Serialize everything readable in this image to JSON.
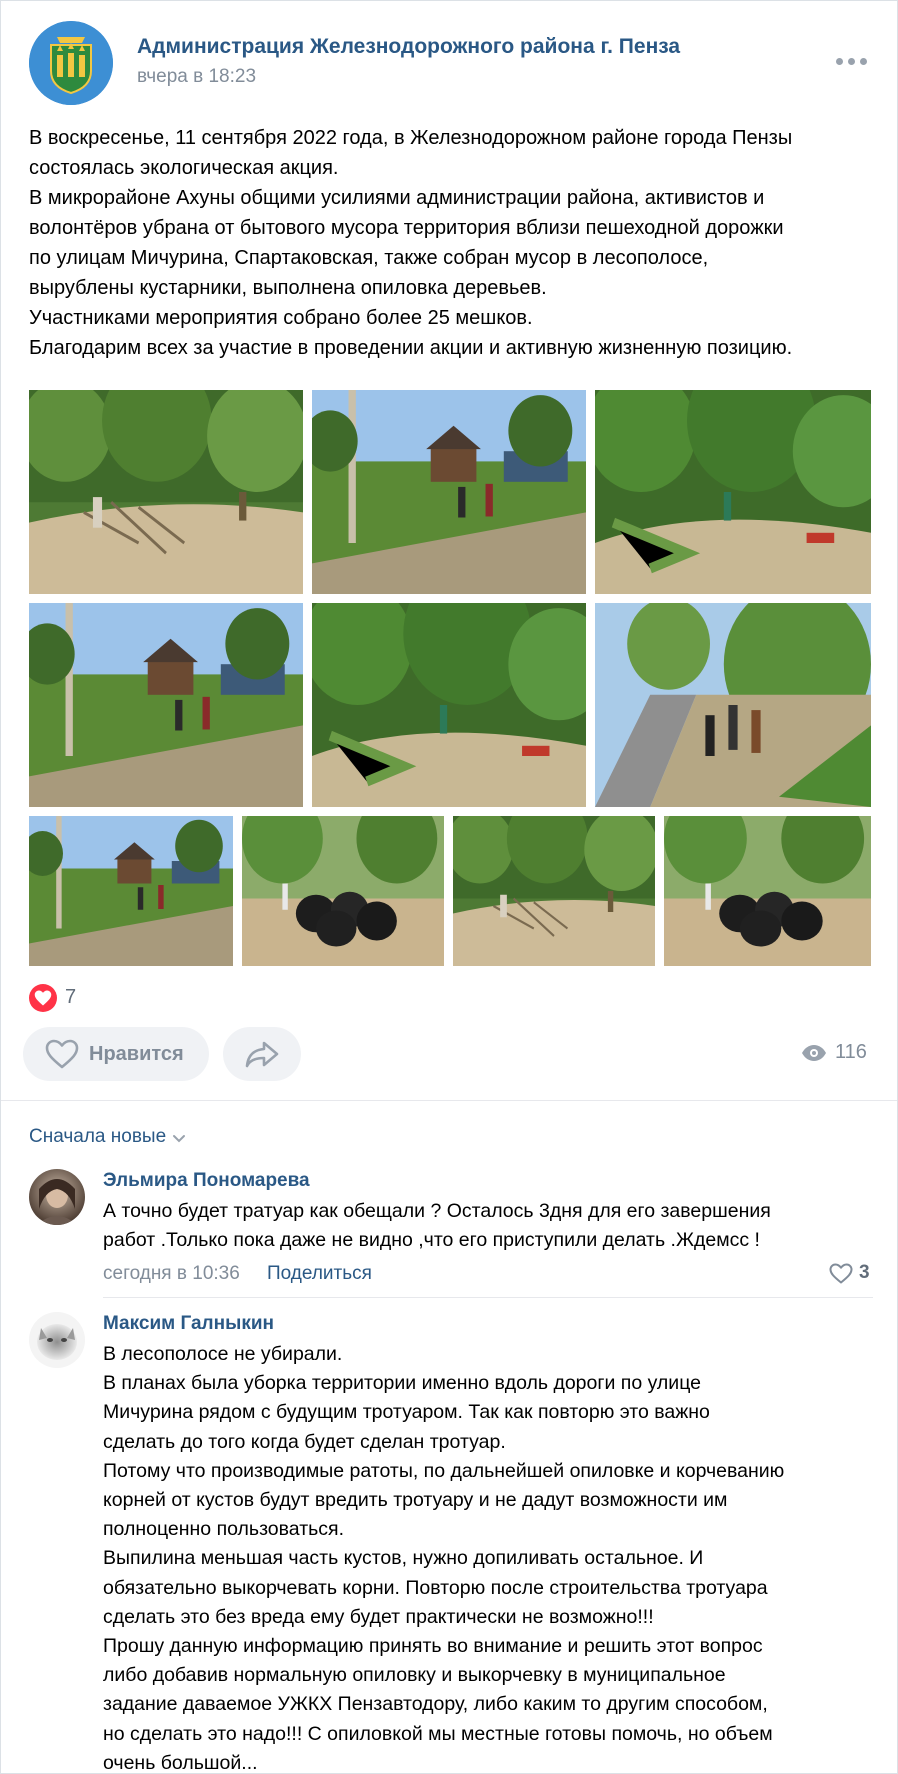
{
  "post": {
    "group_name": "Администрация Железнодорожного района г. Пенза",
    "time": "вчера в 18:23",
    "text_lines": [
      "В воскресенье, 11 сентября 2022 года, в Железнодорожном районе города Пензы",
      "состоялась экологическая акция.",
      "В микрорайоне Ахуны общими усилиями администрации района, активистов и",
      "волонтёров убрана от бытового мусора территория вблизи пешеходной дорожки",
      "по улицам Мичурина, Спартаковская, также собран мусор в лесополосе,",
      "вырублены кустарники, выполнена опиловка деревьев.",
      "Участниками мероприятия собрано более 25 мешков.",
      "Благодарим всех за участие в проведении акции и активную жизненную позицию."
    ],
    "photos": [
      {
        "scene": "trees-sand"
      },
      {
        "scene": "village-road"
      },
      {
        "scene": "forest-edge"
      },
      {
        "scene": "village-road"
      },
      {
        "scene": "forest-edge"
      },
      {
        "scene": "road-people"
      },
      {
        "scene": "village-road"
      },
      {
        "scene": "bags"
      },
      {
        "scene": "trees-sand"
      },
      {
        "scene": "bags"
      }
    ]
  },
  "reactions": {
    "like_count": "7",
    "like_label": "Нравится",
    "views": "116",
    "like_color": "#ff3347"
  },
  "comments_sort": "Сначала новые",
  "comments": [
    {
      "author": "Эльмира Пономарева",
      "lines": [
        "А точно будет тратуар как обещали ? Осталось 3дня для его завершения",
        "работ .Только пока даже не видно ,что его приступили делать .Ждемсс !"
      ],
      "time": "сегодня в 10:36",
      "share_label": "Поделиться",
      "likes": "3"
    },
    {
      "author": "Максим Галныкин",
      "lines": [
        "В лесополосе не убирали.",
        "В планах была уборка территории именно вдоль дороги по улице",
        "Мичурина рядом с будущим тротуаром. Так как повторю это важно",
        "сделать до того когда будет сделан тротуар.",
        "Потому что производимые ратоты, по дальнейшей опиловке и корчеванию",
        "корней от кустов будут вредить тротуару и не дадут возможности им",
        "полноценно пользоваться.",
        "Выпилина меньшая часть кустов, нужно допиливать остальное. И",
        "обязательно выкорчевать корни. Повторю после строительства тротуара",
        "сделать это без вреда ему будет практически не возможно!!!",
        "Прошу данную информацию принять во внимание и решить этот вопрос",
        "либо добавив нормальную опиловку и выкорчевку в муниципальное",
        "задание даваемое УЖКХ Пензавтодору, либо каким то другим способом,",
        "но сделать это надо!!! С опиловкой мы местные готовы помочь, но объем",
        "очень большой..."
      ]
    }
  ],
  "colors": {
    "link": "#2a5885",
    "secondary": "#818c99",
    "button_bg": "#f0f2f5"
  }
}
